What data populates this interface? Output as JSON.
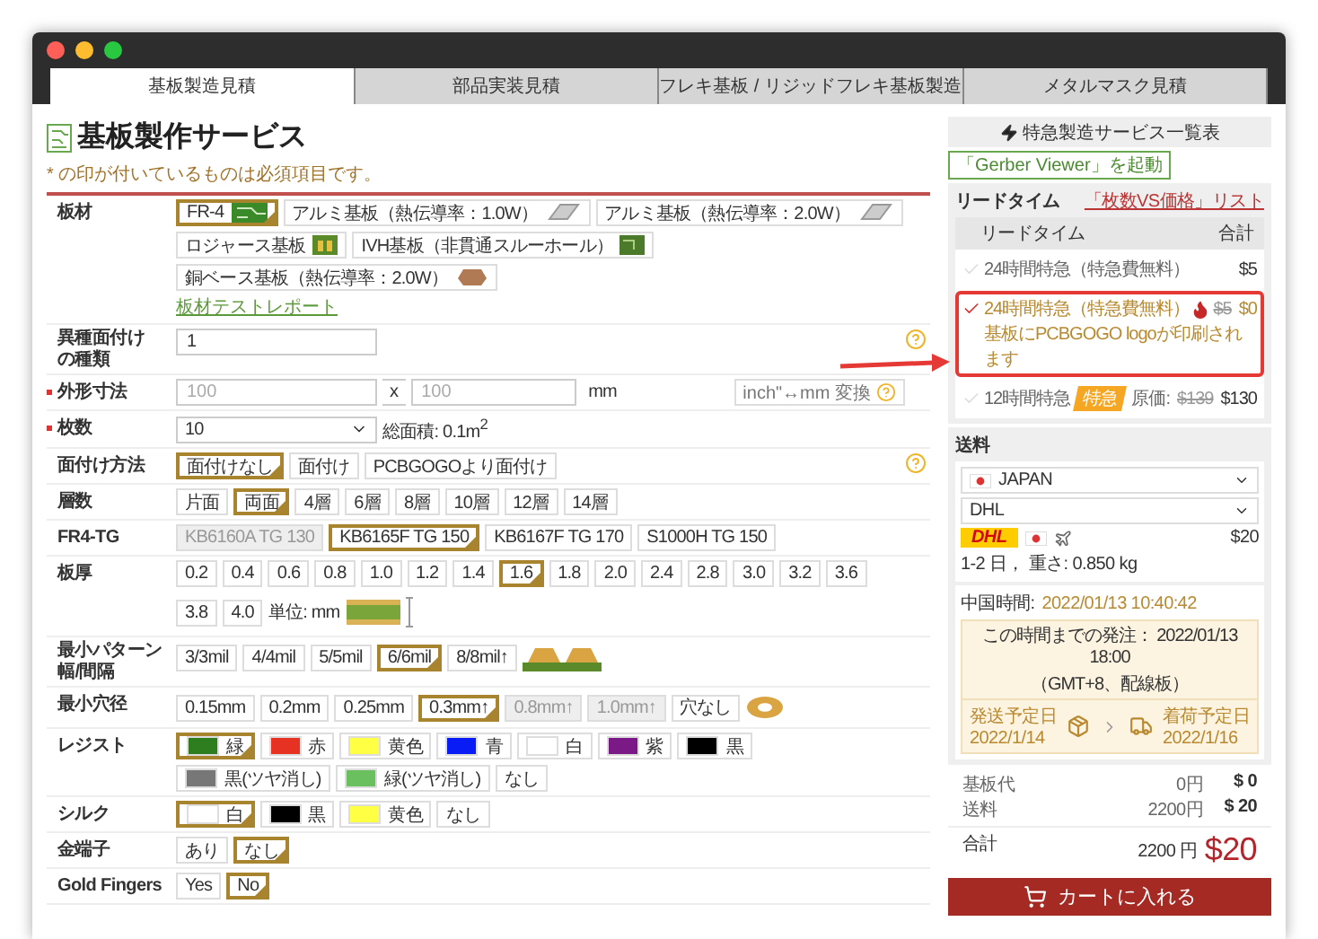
{
  "tabs": [
    {
      "label": "基板製造見積",
      "selected": true
    },
    {
      "label": "部品実装見積",
      "selected": false
    },
    {
      "label": "フレキ基板 / リジッドフレキ基板製造",
      "selected": false
    },
    {
      "label": "メタルマスク見積",
      "selected": false
    }
  ],
  "page": {
    "title": "基板製作サービス",
    "required_note": "* の印が付いているものは必須項目です。"
  },
  "form": {
    "rows": [
      {
        "label": "板材",
        "kind": "material",
        "link": "板材テストレポート",
        "options": [
          {
            "label": "FR-4",
            "selected": true
          },
          {
            "label": "アルミ基板（熱伝導率：1.0W）",
            "selected": false
          },
          {
            "label": "アルミ基板（熱伝導率：2.0W）",
            "selected": false
          },
          {
            "label": "ロジャース基板",
            "selected": false
          },
          {
            "label": "IVH基板（非貫通スルーホール）",
            "selected": false
          },
          {
            "label": "銅ベース基板（熱伝導率：2.0W）",
            "selected": false
          }
        ]
      },
      {
        "label_lines": [
          "異種面付け",
          "の種類"
        ],
        "kind": "input",
        "value": "1",
        "help": true
      },
      {
        "label": "外形寸法",
        "required": true,
        "kind": "size",
        "placeholders": [
          "100",
          "100"
        ],
        "separator": "x",
        "unit": "mm",
        "convert": "inch\"↔mm 変換"
      },
      {
        "label": "枚数",
        "required": true,
        "kind": "select",
        "value": "10",
        "note": "総面積: 0.1m$^{2}$"
      },
      {
        "label": "面付け方法",
        "kind": "chips",
        "help": true,
        "options": [
          {
            "label": "面付けなし",
            "selected": true
          },
          {
            "label": "面付け",
            "selected": false
          },
          {
            "label": "PCBGOGOより面付け",
            "selected": false
          }
        ]
      },
      {
        "label": "層数",
        "kind": "chips",
        "options": [
          {
            "label": "片面",
            "selected": false
          },
          {
            "label": "両面",
            "selected": true
          },
          {
            "label": "4層",
            "selected": false
          },
          {
            "label": "6層",
            "selected": false
          },
          {
            "label": "8層",
            "selected": false
          },
          {
            "label": "10層",
            "selected": false
          },
          {
            "label": "12層",
            "selected": false
          },
          {
            "label": "14層",
            "selected": false
          }
        ]
      },
      {
        "label": "FR4-TG",
        "kind": "chips",
        "options": [
          {
            "label": "KB6160A TG 130",
            "selected": false,
            "disabled": true
          },
          {
            "label": "KB6165F TG 150",
            "selected": true,
            "disabled": false
          },
          {
            "label": "KB6167F TG 170",
            "selected": false,
            "disabled": false
          },
          {
            "label": "S1000H TG 150",
            "selected": false,
            "disabled": false
          }
        ]
      },
      {
        "label": "板厚",
        "kind": "chips",
        "note": "単位: mm",
        "options": [
          {
            "label": "0.2",
            "selected": false
          },
          {
            "label": "0.4",
            "selected": false
          },
          {
            "label": "0.6",
            "selected": false
          },
          {
            "label": "0.8",
            "selected": false
          },
          {
            "label": "1.0",
            "selected": false
          },
          {
            "label": "1.2",
            "selected": false
          },
          {
            "label": "1.4",
            "selected": false
          },
          {
            "label": "1.6",
            "selected": true
          },
          {
            "label": "1.8",
            "selected": false
          },
          {
            "label": "2.0",
            "selected": false
          },
          {
            "label": "2.4",
            "selected": false
          },
          {
            "label": "2.8",
            "selected": false
          },
          {
            "label": "3.0",
            "selected": false
          },
          {
            "label": "3.2",
            "selected": false
          },
          {
            "label": "3.6",
            "selected": false
          },
          {
            "label": "3.8",
            "selected": false
          },
          {
            "label": "4.0",
            "selected": false
          }
        ]
      },
      {
        "label": "最小パターン幅/間隔",
        "kind": "chips",
        "options": [
          {
            "label": "3/3mil",
            "selected": false
          },
          {
            "label": "4/4mil",
            "selected": false
          },
          {
            "label": "5/5mil",
            "selected": false
          },
          {
            "label": "6/6mil",
            "selected": true
          },
          {
            "label": "8/8mil↑",
            "selected": false
          }
        ]
      },
      {
        "label": "最小穴径",
        "kind": "chips",
        "options": [
          {
            "label": "0.15mm",
            "selected": false,
            "disabled": false
          },
          {
            "label": "0.2mm",
            "selected": false,
            "disabled": false
          },
          {
            "label": "0.25mm",
            "selected": false,
            "disabled": false
          },
          {
            "label": "0.3mm↑",
            "selected": true,
            "disabled": false
          },
          {
            "label": "0.8mm↑",
            "selected": false,
            "disabled": true
          },
          {
            "label": "1.0mm↑",
            "selected": false,
            "disabled": true
          },
          {
            "label": "穴なし",
            "selected": false,
            "disabled": false
          }
        ]
      },
      {
        "label": "レジスト",
        "kind": "swatches",
        "options": [
          {
            "label": "緑",
            "color": "#2e7d1f",
            "selected": true
          },
          {
            "label": "赤",
            "color": "#e53222",
            "selected": false
          },
          {
            "label": "黄色",
            "color": "#ffff44",
            "selected": false
          },
          {
            "label": "青",
            "color": "#0a1cf5",
            "selected": false
          },
          {
            "label": "白",
            "color": "#ffffff",
            "selected": false
          },
          {
            "label": "紫",
            "color": "#7b1a86",
            "selected": false
          },
          {
            "label": "黒",
            "color": "#000000",
            "selected": false
          },
          {
            "label": "黒(ツヤ消し)",
            "color": "#777777",
            "selected": false
          },
          {
            "label": "緑(ツヤ消し)",
            "color": "#6abf5e",
            "selected": false
          },
          {
            "label": "なし",
            "selected": false
          }
        ]
      },
      {
        "label": "シルク",
        "kind": "swatches",
        "options": [
          {
            "label": "白",
            "color": "#ffffff",
            "selected": true
          },
          {
            "label": "黒",
            "color": "#000000",
            "selected": false
          },
          {
            "label": "黄色",
            "color": "#ffff44",
            "selected": false
          },
          {
            "label": "なし",
            "selected": false
          }
        ]
      },
      {
        "label": "金端子",
        "kind": "chips",
        "options": [
          {
            "label": "あり",
            "selected": false
          },
          {
            "label": "なし",
            "selected": true
          }
        ]
      },
      {
        "label": "Gold Fingers",
        "kind": "chips",
        "options": [
          {
            "label": "Yes",
            "selected": false
          },
          {
            "label": "No",
            "selected": true
          }
        ]
      }
    ]
  },
  "sidebar": {
    "express_button": "特急製造サービス一覧表",
    "gerber_button": "「Gerber Viewer」を起動",
    "lead_time": {
      "title": "リードタイム",
      "link": "「枚数VS価格」リスト",
      "columns": [
        "リードタイム",
        "合計"
      ],
      "options": [
        {
          "label": "24時間特急（特急費無料）",
          "price": "$5",
          "selected": false
        },
        {
          "label": "24時間特急（特急費無料）",
          "hot": true,
          "note": "基板にPCBGOGO logoが印刷されます",
          "old_price": "$5",
          "price": "$0",
          "selected": true
        },
        {
          "label": "12時間特急",
          "tag": "特急",
          "old_price_label": "原価:",
          "old_price": "$139",
          "price": "$130",
          "selected": false
        }
      ]
    },
    "shipping": {
      "title": "送料",
      "country": "JAPAN",
      "carrier": "DHL",
      "carrier_logo": "DHL",
      "price": "$20",
      "detail": "1-2 日， 重さ: 0.850 kg",
      "china_time_label": "中国時間:",
      "china_time": "2022/01/13 10:40:42",
      "deadline": "この時間までの発注：  2022/01/13 18:00",
      "deadline_note": "（GMT+8、配線板）",
      "ship_label": "発送予定日",
      "ship_date": "2022/1/14",
      "arrive_label": "着荷予定日",
      "arrive_date": "2022/1/16"
    },
    "costs": [
      {
        "label": "基板代",
        "yen": "0円",
        "usd": "$ 0"
      },
      {
        "label": "送料",
        "yen": "2200円",
        "usd": "$ 20"
      }
    ],
    "total": {
      "label": "合計",
      "yen": "2200 円",
      "usd": "$20"
    },
    "cart_button": "カートに入れる"
  }
}
